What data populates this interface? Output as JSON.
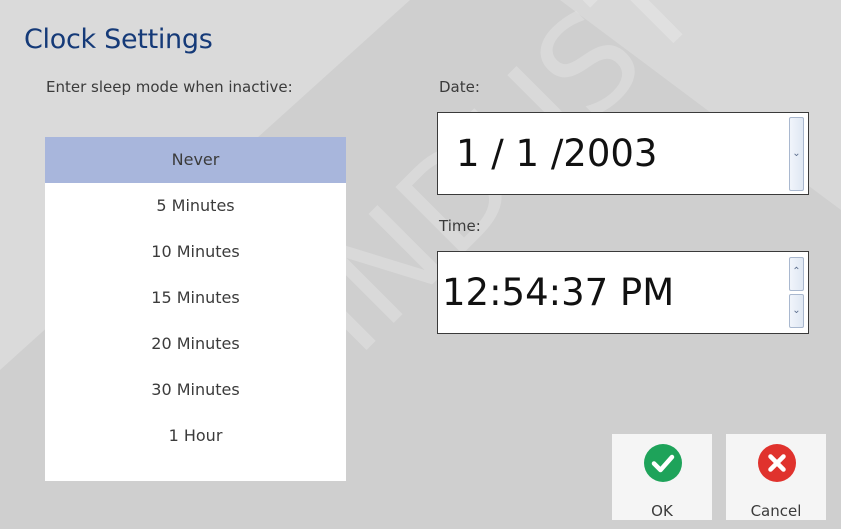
{
  "dialog": {
    "title": "Clock Settings"
  },
  "sleep": {
    "label": "Enter sleep mode when inactive:",
    "options": [
      "Never",
      "5 Minutes",
      "10 Minutes",
      "15 Minutes",
      "20 Minutes",
      "30 Minutes",
      "1 Hour"
    ],
    "selected": "Never"
  },
  "date": {
    "label": "Date:",
    "value": "1 / 1 /2003"
  },
  "time": {
    "label": "Time:",
    "value": "12:54:37 PM"
  },
  "buttons": {
    "ok": "OK",
    "cancel": "Cancel"
  },
  "watermark": {
    "text": "INDUST"
  },
  "colors": {
    "background": "#cfcfcf",
    "title": "#153a78",
    "selected_row": "#a8b6dc",
    "ok_icon": "#1ea35a",
    "cancel_icon": "#e0322d"
  },
  "icons": {
    "ok": "checkmark-icon",
    "cancel": "x-icon"
  }
}
